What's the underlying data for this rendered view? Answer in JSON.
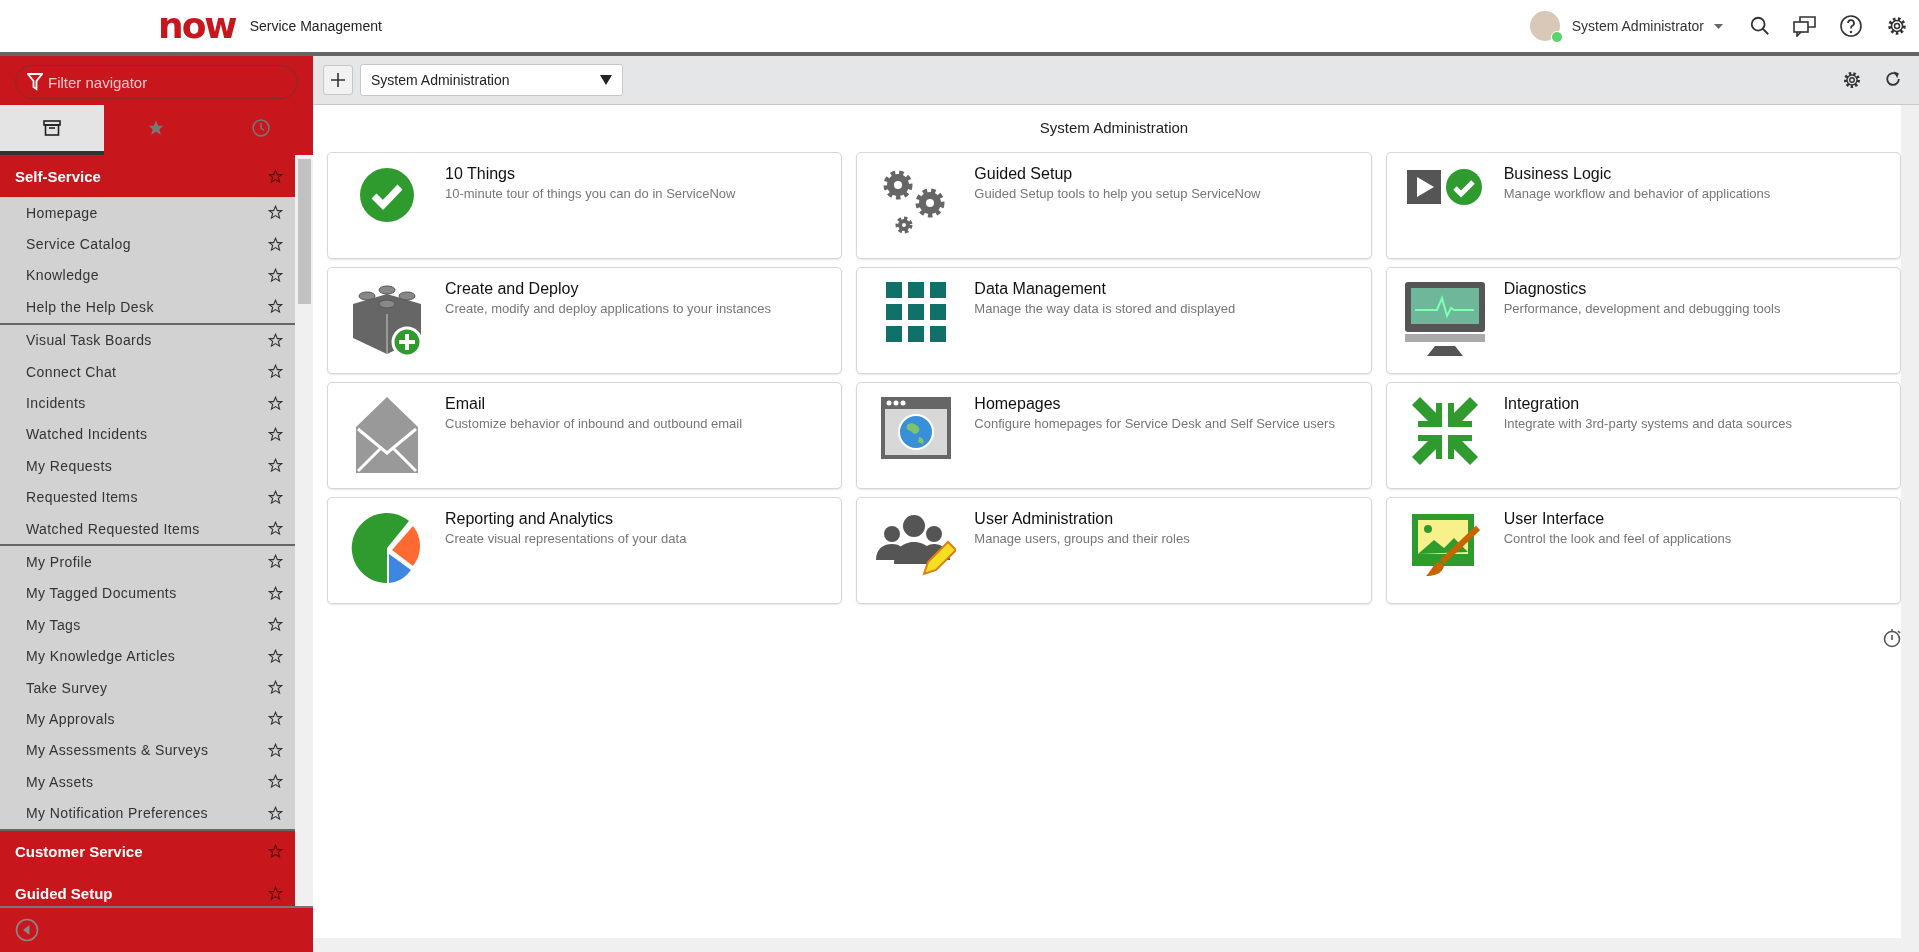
{
  "header": {
    "logo": "now",
    "product": "Service Management",
    "user": "System Administrator"
  },
  "navigator": {
    "filter": {
      "placeholder": "Filter navigator"
    },
    "tabs": [
      {
        "selected": true
      },
      {
        "selected": false
      },
      {
        "selected": false
      }
    ],
    "modules": [
      {
        "title": "Self-Service",
        "groups": [
          [
            "Homepage",
            "Service Catalog",
            "Knowledge",
            "Help the Help Desk"
          ],
          [
            "Visual Task Boards",
            "Connect Chat",
            "Incidents",
            "Watched Incidents",
            "My Requests",
            "Requested Items",
            "Watched Requested Items"
          ],
          [
            "My Profile",
            "My Tagged Documents",
            "My Tags",
            "My Knowledge Articles",
            "Take Survey",
            "My Approvals",
            "My Assessments & Surveys",
            "My Assets",
            "My Notification Preferences"
          ]
        ]
      },
      {
        "title": "Customer Service"
      },
      {
        "title": "Guided Setup"
      }
    ]
  },
  "toolbar": {
    "dashboard": "System Administration"
  },
  "page": {
    "title": "System Administration",
    "cards": [
      {
        "title": "10 Things",
        "description": "10-minute tour of things you can do in ServiceNow"
      },
      {
        "title": "Guided Setup",
        "description": "Guided Setup tools to help you setup ServiceNow"
      },
      {
        "title": "Business Logic",
        "description": "Manage workflow and behavior of applications"
      },
      {
        "title": "Create and Deploy",
        "description": "Create, modify and deploy applications to your instances"
      },
      {
        "title": "Data Management",
        "description": "Manage the way data is stored and displayed"
      },
      {
        "title": "Diagnostics",
        "description": "Performance, development and debugging tools"
      },
      {
        "title": "Email",
        "description": "Customize behavior of inbound and outbound email"
      },
      {
        "title": "Homepages",
        "description": "Configure homepages for Service Desk and Self Service users"
      },
      {
        "title": "Integration",
        "description": "Integrate with 3rd-party systems and data sources"
      },
      {
        "title": "Reporting and Analytics",
        "description": "Create visual representations of your data"
      },
      {
        "title": "User Administration",
        "description": "Manage users, groups and their roles"
      },
      {
        "title": "User Interface",
        "description": "Control the look and feel of applications"
      }
    ]
  }
}
